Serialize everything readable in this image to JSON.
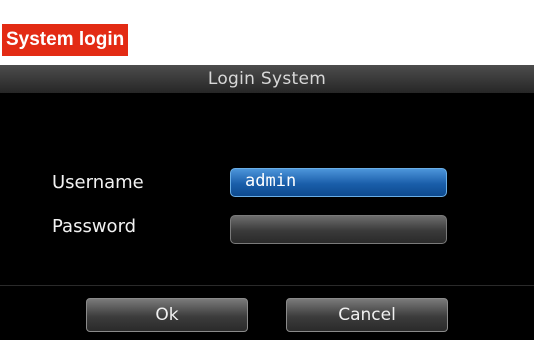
{
  "section_label": "System login",
  "dialog": {
    "title": "Login System",
    "username_label": "Username",
    "username_value": "admin",
    "password_label": "Password",
    "password_value": "",
    "ok_label": "Ok",
    "cancel_label": "Cancel"
  },
  "colors": {
    "section_label_bg": "#e32b14",
    "dialog_bg": "#000000",
    "focused_input": "#1a5eaa"
  }
}
